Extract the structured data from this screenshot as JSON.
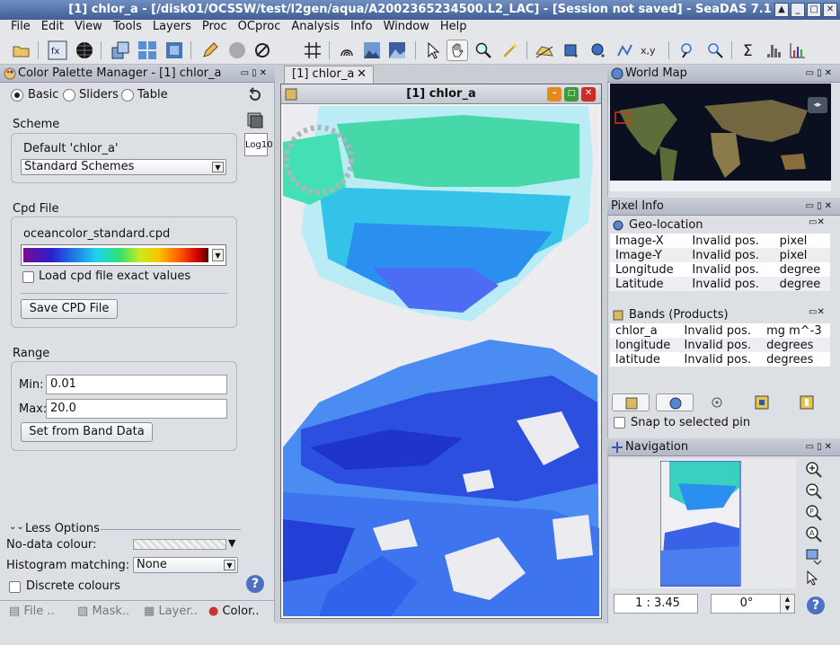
{
  "window": {
    "title": "[1] chlor_a - [/disk01/OCSSW/test/l2gen/aqua/A2002365234500.L2_LAC] - [Session not saved] - SeaDAS 7.1"
  },
  "menu": [
    "File",
    "Edit",
    "View",
    "Tools",
    "Layers",
    "Proc",
    "OCproc",
    "Analysis",
    "Info",
    "Window",
    "Help"
  ],
  "cpm": {
    "header": "Color Palette Manager - [1] chlor_a",
    "modes": [
      "Basic",
      "Sliders",
      "Table"
    ],
    "selected_mode": "Basic",
    "scheme_title": "Scheme",
    "scheme_default": "Default 'chlor_a'",
    "scheme_select": "Standard Schemes",
    "cpd_title": "Cpd File",
    "cpd_file": "oceancolor_standard.cpd",
    "load_exact": "Load cpd file exact values",
    "save_cpd": "Save CPD File",
    "range_title": "Range",
    "min_label": "Min:",
    "min_value": "0.01",
    "max_label": "Max:",
    "max_value": "20.0",
    "set_from_band": "Set from Band Data",
    "log_label": "Log10",
    "less_options": "Less Options",
    "nodata_label": "No-data colour:",
    "hist_label": "Histogram matching:",
    "hist_value": "None",
    "discrete": "Discrete colours",
    "bottom_tabs": [
      "File ..",
      "Mask..",
      "Layer..",
      "Color.."
    ]
  },
  "image_view": {
    "tab": "[1] chlor_a",
    "title": "[1] chlor_a"
  },
  "world_map": {
    "header": "World Map"
  },
  "pixel_info": {
    "header": "Pixel Info",
    "geo_header": "Geo-location",
    "geo_rows": [
      {
        "name": "Image-X",
        "value": "Invalid pos.",
        "unit": "pixel"
      },
      {
        "name": "Image-Y",
        "value": "Invalid pos.",
        "unit": "pixel"
      },
      {
        "name": "Longitude",
        "value": "Invalid pos.",
        "unit": "degree"
      },
      {
        "name": "Latitude",
        "value": "Invalid pos.",
        "unit": "degree"
      }
    ],
    "bands_header": "Bands (Products)",
    "band_rows": [
      {
        "name": "chlor_a",
        "value": "Invalid pos.",
        "unit": "mg m^-3"
      },
      {
        "name": "longitude",
        "value": "Invalid pos.",
        "unit": "degrees"
      },
      {
        "name": "latitude",
        "value": "Invalid pos.",
        "unit": "degrees"
      }
    ],
    "snap": "Snap to selected pin"
  },
  "navigation": {
    "header": "Navigation",
    "zoom": "1 : 3.45",
    "rotation": "0°"
  }
}
